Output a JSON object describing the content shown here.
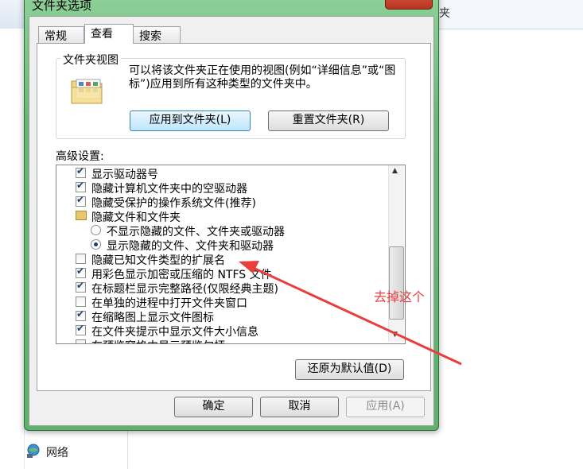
{
  "background": {
    "top_right_text": "夹",
    "nav_network_label": "网络"
  },
  "dialog": {
    "title": "文件夹选项",
    "close_glyph": "✕",
    "tabs": [
      {
        "label": "常规",
        "active": false
      },
      {
        "label": "查看",
        "active": true
      },
      {
        "label": "搜索",
        "active": false
      }
    ],
    "folder_view": {
      "group_title": "文件夹视图",
      "description": "可以将该文件夹正在使用的视图(例如“详细信息”或“图标”)应用到所有这种类型的文件夹中。",
      "apply_button": "应用到文件夹(L)",
      "reset_button": "重置文件夹(R)"
    },
    "advanced_label": "高级设置:",
    "advanced_items": [
      {
        "type": "checkbox",
        "checked": true,
        "label": "显示驱动器号"
      },
      {
        "type": "checkbox",
        "checked": true,
        "label": "隐藏计算机文件夹中的空驱动器"
      },
      {
        "type": "checkbox",
        "checked": true,
        "label": "隐藏受保护的操作系统文件(推荐)"
      },
      {
        "type": "folder",
        "label": "隐藏文件和文件夹"
      },
      {
        "type": "radio",
        "checked": false,
        "label": "不显示隐藏的文件、文件夹或驱动器"
      },
      {
        "type": "radio",
        "checked": true,
        "label": "显示隐藏的文件、文件夹和驱动器"
      },
      {
        "type": "checkbox",
        "checked": false,
        "label": "隐藏已知文件类型的扩展名"
      },
      {
        "type": "checkbox",
        "checked": true,
        "label": "用彩色显示加密或压缩的 NTFS 文件"
      },
      {
        "type": "checkbox",
        "checked": true,
        "label": "在标题栏显示完整路径(仅限经典主题)"
      },
      {
        "type": "checkbox",
        "checked": false,
        "label": "在单独的进程中打开文件夹窗口"
      },
      {
        "type": "checkbox",
        "checked": true,
        "label": "在缩略图上显示文件图标"
      },
      {
        "type": "checkbox",
        "checked": true,
        "label": "在文件夹提示中显示文件大小信息"
      },
      {
        "type": "checkbox",
        "checked": false,
        "label": "在预览窗格中显示预览句柄"
      }
    ],
    "restore_button": "还原为默认值(D)",
    "ok_button": "确定",
    "cancel_button": "取消",
    "apply_button": "应用(A)"
  },
  "annotation": {
    "text": "去掉这个",
    "color": "#ea3d3d"
  }
}
